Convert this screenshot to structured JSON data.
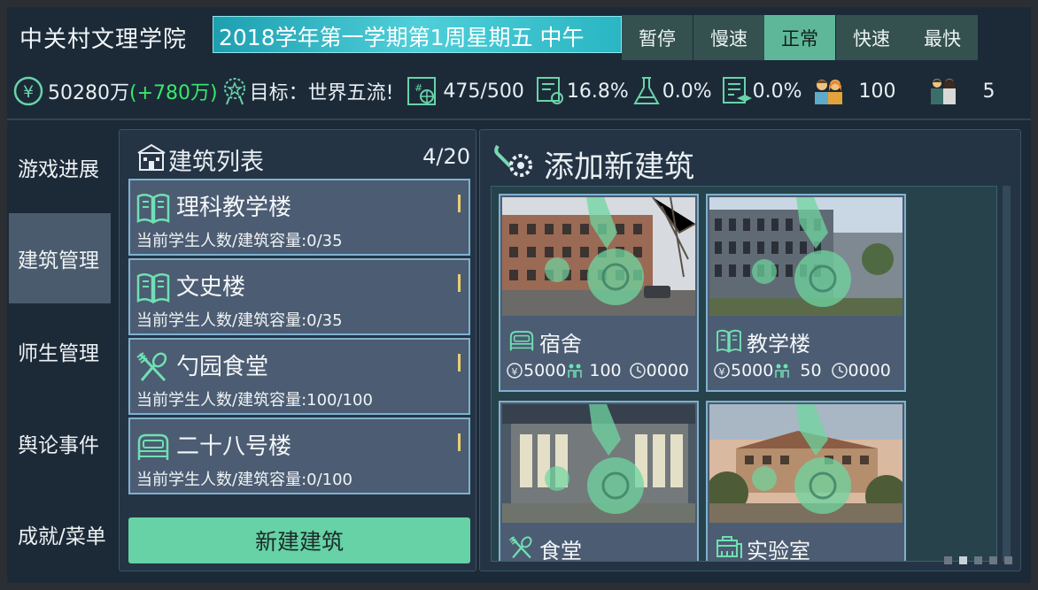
{
  "header": {
    "school_name": "中关村文理学院",
    "date_text": "2018学年第一学期第1周星期五 中午",
    "speed_buttons": [
      "暂停",
      "慢速",
      "正常",
      "快速",
      "最快"
    ],
    "active_speed": "正常"
  },
  "stats": {
    "money": "50280万",
    "money_delta": "(+780万)",
    "goal": "目标：世界五流!",
    "capacity": "475/500",
    "stat_rate_1": "16.8%",
    "stat_rate_2": "0.0%",
    "stat_rate_3": "0.0%",
    "teachers": "100",
    "staff": "5"
  },
  "sidebar": {
    "items": [
      "游戏进展",
      "建筑管理",
      "师生管理",
      "舆论事件",
      "成就/菜单"
    ],
    "active": "建筑管理"
  },
  "building_list": {
    "title": "建筑列表",
    "count": "4/20",
    "items": [
      {
        "name": "理科教学楼",
        "info": "当前学生人数/建筑容量:0/35",
        "icon": "book-icon"
      },
      {
        "name": "文史楼",
        "info": "当前学生人数/建筑容量:0/35",
        "icon": "book-icon"
      },
      {
        "name": "勺园食堂",
        "info": "当前学生人数/建筑容量:100/100",
        "icon": "utensils-icon"
      },
      {
        "name": "二十八号楼",
        "info": "当前学生人数/建筑容量:0/100",
        "icon": "bed-icon"
      }
    ],
    "new_button": "新建建筑"
  },
  "add_panel": {
    "title": "添加新建筑",
    "types": [
      {
        "name": "宿舍",
        "cost": "5000",
        "capacity": "100",
        "time": "0000",
        "icon": "bed-icon"
      },
      {
        "name": "教学楼",
        "cost": "5000",
        "capacity": "50",
        "time": "0000",
        "icon": "book-icon"
      },
      {
        "name": "食堂",
        "icon": "utensils-icon"
      },
      {
        "name": "实验室",
        "icon": "lab-icon"
      }
    ]
  },
  "colors": {
    "accent": "#66d2a6",
    "positive": "#36e86a",
    "card_bg": "#4c5c72",
    "card_border": "#7fb1cf"
  }
}
